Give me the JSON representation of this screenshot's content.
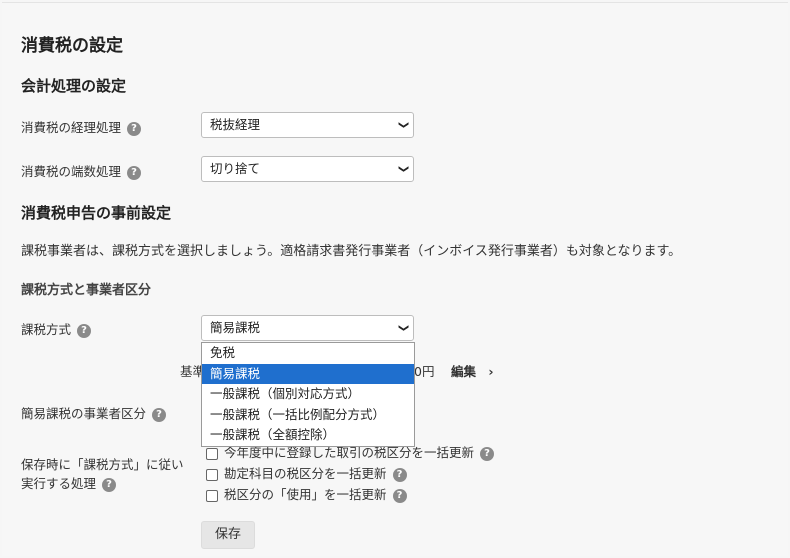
{
  "page_title": "消費税の設定",
  "section_accounting": {
    "title": "会計処理の設定",
    "tax_accounting": {
      "label": "消費税の経理処理",
      "value": "税抜経理"
    },
    "rounding": {
      "label": "消費税の端数処理",
      "value": "切り捨て"
    }
  },
  "section_prefiling": {
    "title": "消費税申告の事前設定",
    "description": "課税事業者は、課税方式を選択しましょう。適格請求書発行事業者（インボイス発行事業者）も対象となります。",
    "subheading": "課税方式と事業者区分",
    "tax_method": {
      "label": "課税方式",
      "value": "簡易課税",
      "options": [
        "免税",
        "簡易課税",
        "一般課税（個別対応方式）",
        "一般課税（一括比例配分方式）",
        "一般課税（全額控除）"
      ],
      "selected_index": 1
    },
    "basis": {
      "label_prefix": "基準",
      "amount_suffix": "0円",
      "edit_label": "編集",
      "edit_chevron": "›"
    },
    "business_category": {
      "label": "簡易課税の事業者区分"
    },
    "on_save": {
      "label_line1": "保存時に「課税方式」に従い",
      "label_line2": "実行する処理",
      "options": [
        "今年度中に登録した取引の税区分を一括更新",
        "勘定科目の税区分を一括更新",
        "税区分の「使用」を一括更新"
      ]
    },
    "save_label": "保存"
  },
  "icons": {
    "help": "question-circle-icon",
    "chevron": "chevron-down-icon"
  },
  "colors": {
    "selected_option_bg": "#1f6fce"
  }
}
